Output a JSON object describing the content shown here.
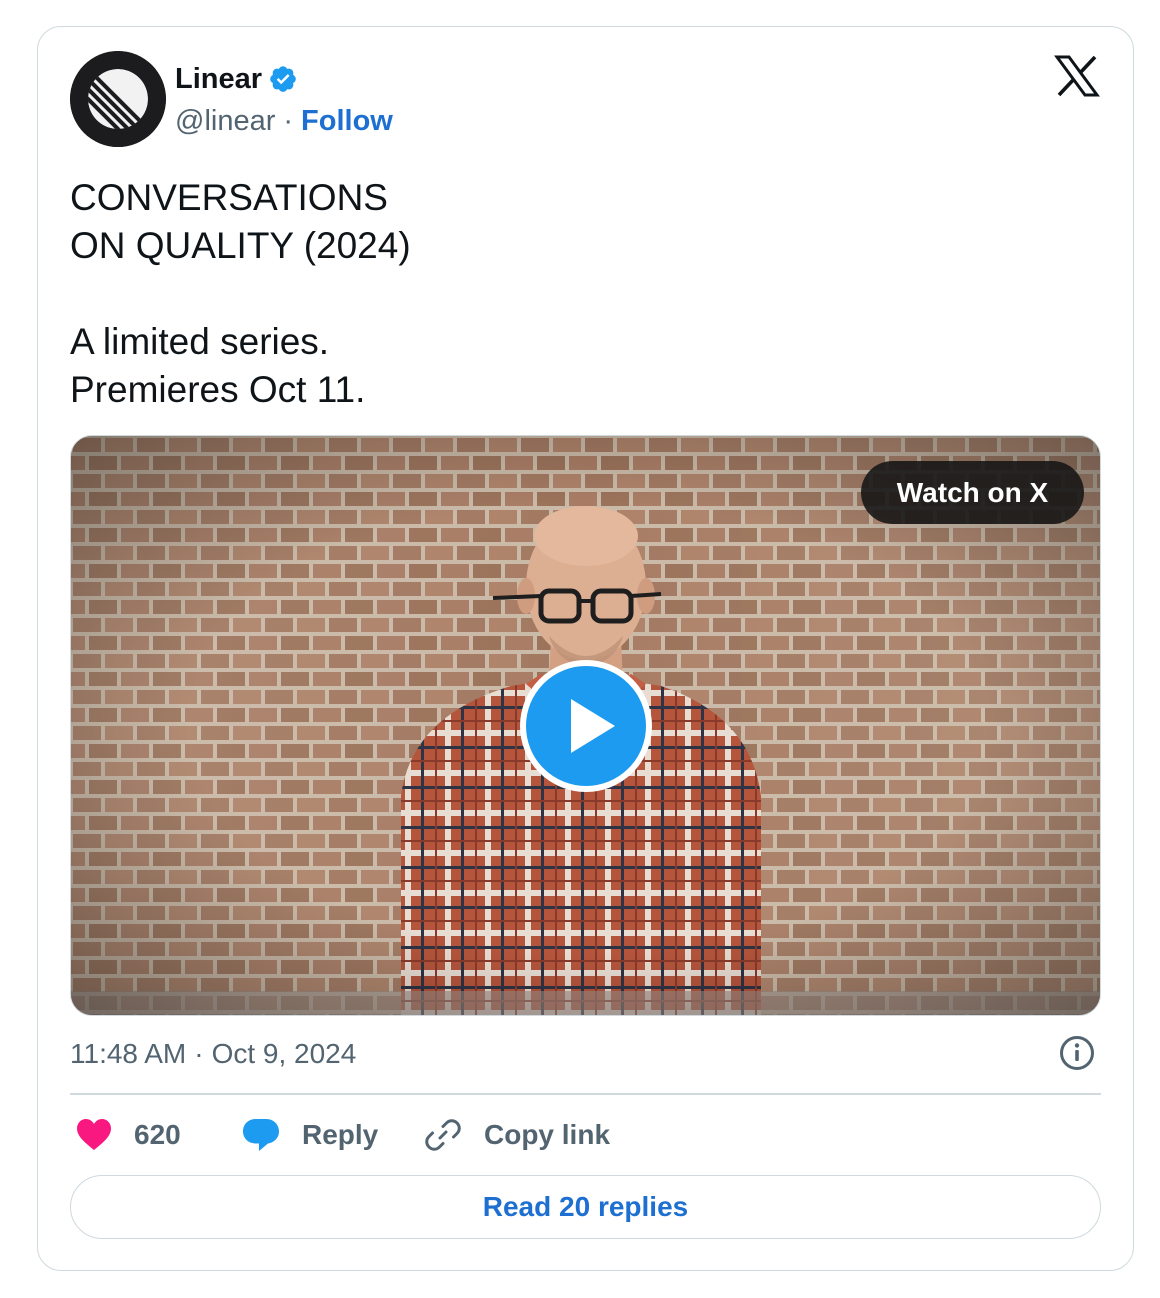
{
  "author": {
    "name": "Linear",
    "handle": "@linear",
    "separator": "·",
    "follow_label": "Follow",
    "verified": true
  },
  "tweet": {
    "lines": [
      "CONVERSATIONS",
      "ON QUALITY (2024)",
      "",
      "A limited series.",
      "Premieres Oct 11."
    ]
  },
  "media": {
    "type": "video",
    "watch_label": "Watch on X",
    "play_icon": "play-icon"
  },
  "meta": {
    "time": "11:48 AM",
    "separator": "·",
    "date": "Oct 9, 2024"
  },
  "actions": {
    "likes_count": "620",
    "reply_label": "Reply",
    "copy_link_label": "Copy link"
  },
  "read_replies_label": "Read 20 replies",
  "colors": {
    "accent": "#1d9bf0",
    "link": "#1d6fd1",
    "like": "#f91880",
    "play": "#1d9bf0",
    "border": "#cfd9de",
    "text_primary": "#0f1419",
    "text_secondary": "#536471"
  }
}
